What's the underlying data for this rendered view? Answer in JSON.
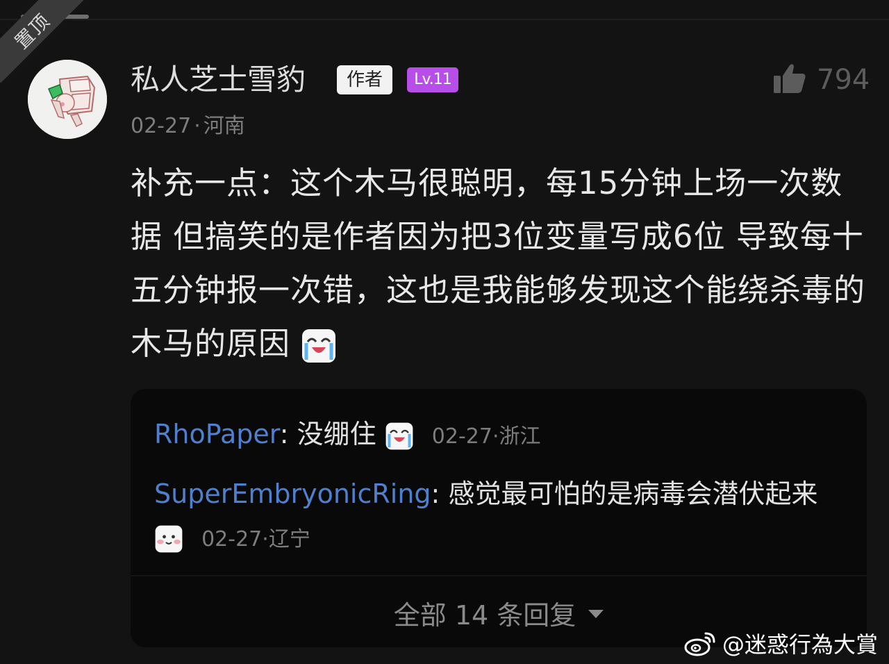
{
  "pinned_label": "置顶",
  "comment": {
    "username": "私人芝士雪豹",
    "author_badge": "作者",
    "level_badge": "Lv.11",
    "likes": "794",
    "date": "02-27",
    "separator": "·",
    "location": "河南",
    "text": "补充一点：这个木马很聪明，每15分钟上场一次数据 但搞笑的是作者因为把3位变量写成6位 导致每十五分钟报一次错，这也是我能够发现这个能绕杀毒的木马的原因",
    "trailing_emoji": "laugh-cry-emoji"
  },
  "replies": [
    {
      "author": "RhoPaper",
      "colon": ": ",
      "text": "没绷住",
      "emoji": "laugh-cry-emoji",
      "date": "02-27",
      "separator": "·",
      "location": "浙江"
    },
    {
      "author": "SuperEmbryonicRing",
      "colon": ": ",
      "text": "感觉最可怕的是病毒会潜伏起来",
      "emoji": "shy-smile-emoji",
      "date": "02-27",
      "separator": "·",
      "location": "辽宁"
    }
  ],
  "view_all_replies": "全部 14 条回复",
  "watermark": "@迷惑行為大賞",
  "colors": {
    "background": "#131313",
    "level_badge": "#b84ee8",
    "reply_author": "#4f7fcd",
    "reply_box": "#090909"
  }
}
